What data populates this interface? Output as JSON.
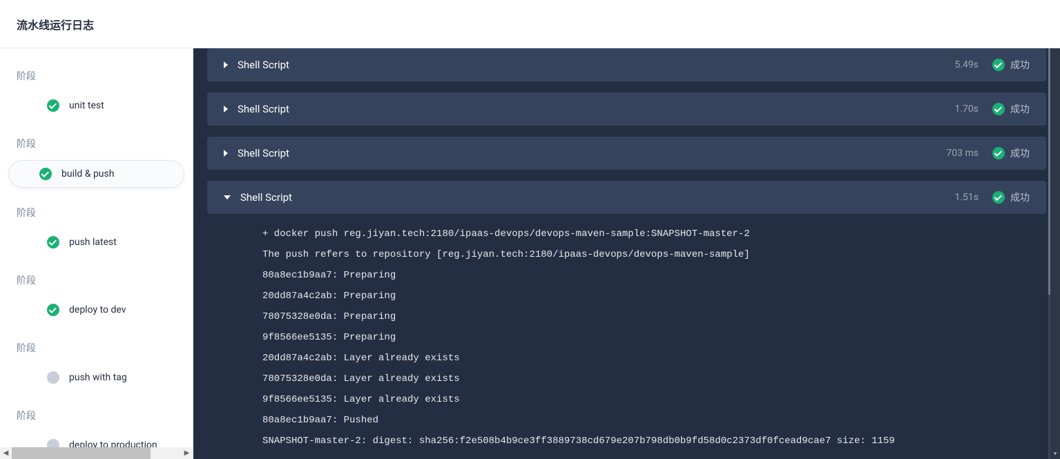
{
  "header": {
    "title": "流水线运行日志"
  },
  "sidebar": {
    "stage_label": "阶段",
    "stages": [
      {
        "status": "success",
        "name": "unit test",
        "active": false
      },
      {
        "status": "success",
        "name": "build & push",
        "active": true
      },
      {
        "status": "success",
        "name": "push latest",
        "active": false
      },
      {
        "status": "success",
        "name": "deploy to dev",
        "active": false
      },
      {
        "status": "pending",
        "name": "push with tag",
        "active": false
      },
      {
        "status": "pending",
        "name": "deploy to production",
        "active": false
      }
    ]
  },
  "steps": [
    {
      "title": "Shell Script",
      "duration": "5.49s",
      "status_text": "成功",
      "status": "success",
      "expanded": false
    },
    {
      "title": "Shell Script",
      "duration": "1.70s",
      "status_text": "成功",
      "status": "success",
      "expanded": false
    },
    {
      "title": "Shell Script",
      "duration": "703 ms",
      "status_text": "成功",
      "status": "success",
      "expanded": false
    },
    {
      "title": "Shell Script",
      "duration": "1.51s",
      "status_text": "成功",
      "status": "success",
      "expanded": true,
      "log": "+ docker push reg.jiyan.tech:2180/ipaas-devops/devops-maven-sample:SNAPSHOT-master-2\nThe push refers to repository [reg.jiyan.tech:2180/ipaas-devops/devops-maven-sample]\n80a8ec1b9aa7: Preparing\n20dd87a4c2ab: Preparing\n78075328e0da: Preparing\n9f8566ee5135: Preparing\n20dd87a4c2ab: Layer already exists\n78075328e0da: Layer already exists\n9f8566ee5135: Layer already exists\n80a8ec1b9aa7: Pushed\nSNAPSHOT-master-2: digest: sha256:f2e508b4b9ce3ff3889738cd679e207b798db0b9fd58d0c2373df0fcead9cae7 size: 1159"
    }
  ]
}
